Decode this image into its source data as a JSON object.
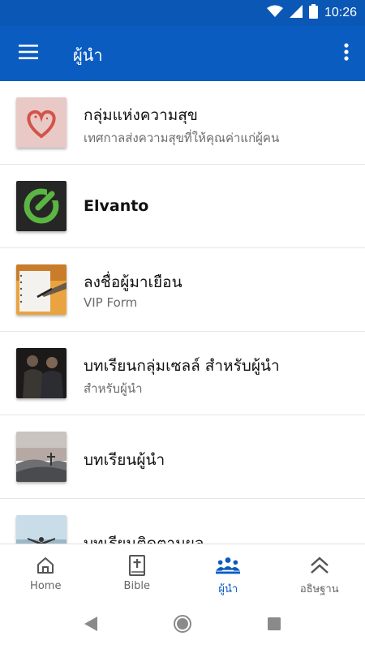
{
  "status_bar": {
    "time": "10:26"
  },
  "app_bar": {
    "title": "ผู้นำ"
  },
  "list": {
    "items": [
      {
        "title": "กลุ่มแห่งความสุข",
        "subtitle": "เทศกาลส่งความสุขที่ให้คุณค่าแก่ผู้คน"
      },
      {
        "title": "Elvanto",
        "subtitle": ""
      },
      {
        "title": "ลงชื่อผู้มาเยือน",
        "subtitle": "VIP Form"
      },
      {
        "title": "บทเรียนกลุ่มเซลล์ สำหรับผู้นำ",
        "subtitle": "สำหรับผู้นำ"
      },
      {
        "title": "บทเรียนผู้นำ",
        "subtitle": ""
      },
      {
        "title": "บทเรียนติดตามผล",
        "subtitle": ""
      }
    ]
  },
  "bottom_nav": {
    "items": [
      {
        "label": "Home",
        "icon": "home-icon"
      },
      {
        "label": "Bible",
        "icon": "bible-icon"
      },
      {
        "label": "ผู้นำ",
        "icon": "group-icon",
        "active": true
      },
      {
        "label": "อธิษฐาน",
        "icon": "double-chevron-up-icon"
      }
    ]
  },
  "colors": {
    "primary": "#0a5cc0",
    "status_bar": "#0a57b5",
    "accent_green": "#5bb543"
  }
}
